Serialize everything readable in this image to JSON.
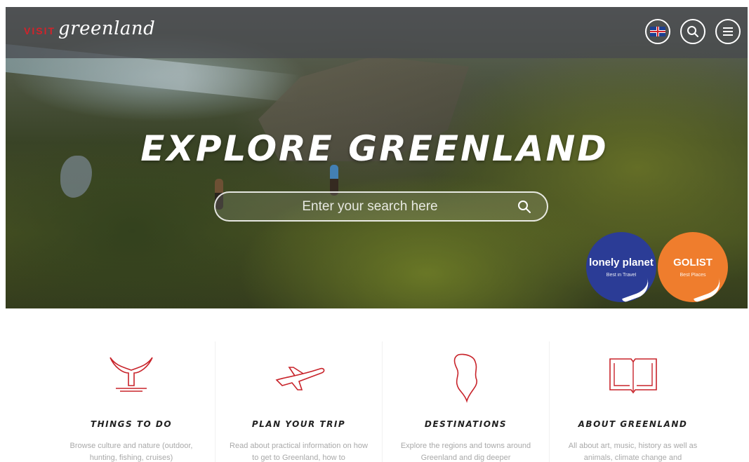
{
  "header": {
    "logo_visit": "VISIT",
    "logo_greenland": "greenland",
    "language_icon": "uk-flag-icon",
    "search_icon": "search-icon",
    "menu_icon": "hamburger-menu-icon"
  },
  "hero": {
    "title": "EXPLORE GREENLAND",
    "search_placeholder": "Enter your search here"
  },
  "badges": [
    {
      "title": "lonely planet",
      "subtitle": "Best in Travel",
      "color": "#2b3c96"
    },
    {
      "title": "GOLIST",
      "subtitle": "Best Places",
      "color": "#ef7d2d"
    }
  ],
  "cards": [
    {
      "icon": "whale-tail-icon",
      "title": "THINGS TO DO",
      "desc": "Browse culture and nature (outdoor, hunting, fishing, cruises)"
    },
    {
      "icon": "airplane-icon",
      "title": "PLAN YOUR TRIP",
      "desc": "Read about practical information on how to get to Greenland, how to"
    },
    {
      "icon": "greenland-map-icon",
      "title": "DESTINATIONS",
      "desc": "Explore the regions and towns around Greenland and dig deeper"
    },
    {
      "icon": "open-book-icon",
      "title": "ABOUT GREENLAND",
      "desc": "All about art, music, history as well as animals, climate change and"
    }
  ],
  "colors": {
    "brand_red": "#d2232a",
    "icon_red": "#c8232a"
  }
}
